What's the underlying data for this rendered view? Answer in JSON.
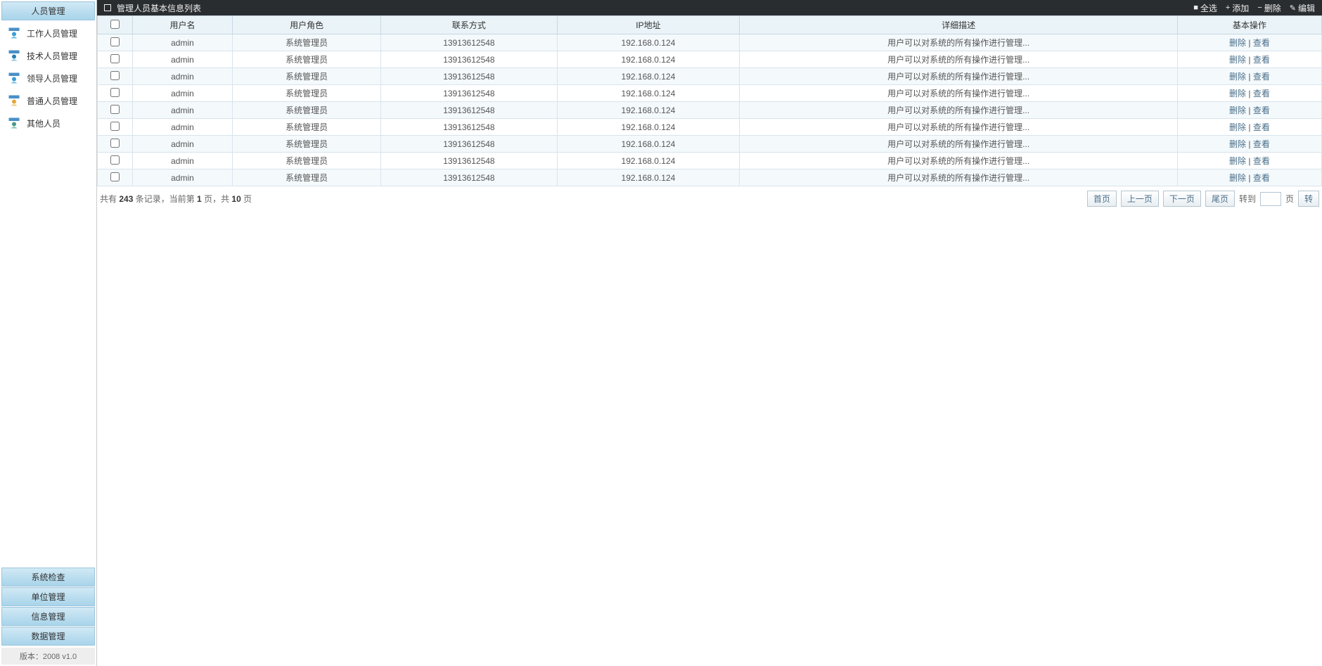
{
  "sidebar": {
    "header": "人员管理",
    "items": [
      {
        "label": "工作人员管理",
        "icon_color": "#3b9cd6",
        "icon_accent": "#5fb8e8"
      },
      {
        "label": "技术人员管理",
        "icon_color": "#2b7fb0",
        "icon_accent": "#88c5e6"
      },
      {
        "label": "领导人员管理",
        "icon_color": "#3b9cd6",
        "icon_accent": "#6fbfe8"
      },
      {
        "label": "普通人员管理",
        "icon_color": "#e6a83b",
        "icon_accent": "#f0c878"
      },
      {
        "label": "其他人员",
        "icon_color": "#4a9688",
        "icon_accent": "#7fbfb0"
      }
    ],
    "bottom_items": [
      "系统检查",
      "单位管理",
      "信息管理",
      "数据管理"
    ],
    "version": "版本：2008 v1.0"
  },
  "titlebar": {
    "title": "管理人员基本信息列表",
    "actions": {
      "select_all": "全选",
      "add": "添加",
      "delete": "删除",
      "edit": "编辑"
    }
  },
  "table": {
    "headers": {
      "checkbox": "",
      "username": "用户名",
      "role": "用户角色",
      "contact": "联系方式",
      "ip": "IP地址",
      "description": "详细描述",
      "operation": "基本操作"
    },
    "action_labels": {
      "delete": "删除",
      "view": "查看",
      "sep": " | "
    },
    "rows": [
      {
        "username": "admin",
        "role": "系统管理员",
        "contact": "13913612548",
        "ip": "192.168.0.124",
        "description": "用户可以对系统的所有操作进行管理..."
      },
      {
        "username": "admin",
        "role": "系统管理员",
        "contact": "13913612548",
        "ip": "192.168.0.124",
        "description": "用户可以对系统的所有操作进行管理..."
      },
      {
        "username": "admin",
        "role": "系统管理员",
        "contact": "13913612548",
        "ip": "192.168.0.124",
        "description": "用户可以对系统的所有操作进行管理..."
      },
      {
        "username": "admin",
        "role": "系统管理员",
        "contact": "13913612548",
        "ip": "192.168.0.124",
        "description": "用户可以对系统的所有操作进行管理..."
      },
      {
        "username": "admin",
        "role": "系统管理员",
        "contact": "13913612548",
        "ip": "192.168.0.124",
        "description": "用户可以对系统的所有操作进行管理..."
      },
      {
        "username": "admin",
        "role": "系统管理员",
        "contact": "13913612548",
        "ip": "192.168.0.124",
        "description": "用户可以对系统的所有操作进行管理..."
      },
      {
        "username": "admin",
        "role": "系统管理员",
        "contact": "13913612548",
        "ip": "192.168.0.124",
        "description": "用户可以对系统的所有操作进行管理..."
      },
      {
        "username": "admin",
        "role": "系统管理员",
        "contact": "13913612548",
        "ip": "192.168.0.124",
        "description": "用户可以对系统的所有操作进行管理..."
      },
      {
        "username": "admin",
        "role": "系统管理员",
        "contact": "13913612548",
        "ip": "192.168.0.124",
        "description": "用户可以对系统的所有操作进行管理..."
      }
    ]
  },
  "pagination": {
    "info_prefix": "共有 ",
    "total_records": "243",
    "info_mid1": " 条记录，当前第 ",
    "current_page": "1",
    "info_mid2": " 页，共 ",
    "total_pages": "10",
    "info_suffix": " 页",
    "first": "首页",
    "prev": "上一页",
    "next": "下一页",
    "last": "尾页",
    "goto_label": "转到",
    "page_unit": "页",
    "go_btn": "转"
  }
}
